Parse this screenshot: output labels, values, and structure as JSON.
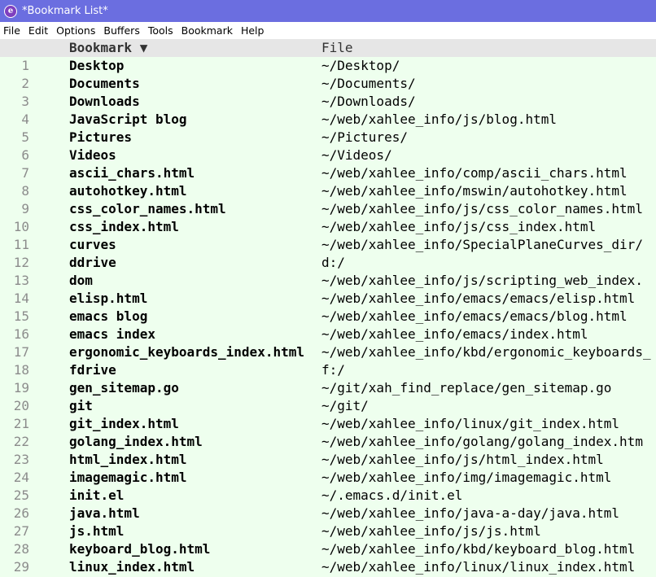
{
  "window": {
    "title": "*Bookmark List*",
    "icon": "emacs-icon"
  },
  "menubar": [
    "File",
    "Edit",
    "Options",
    "Buffers",
    "Tools",
    "Bookmark",
    "Help"
  ],
  "header": {
    "bookmark": "Bookmark ▼",
    "file": "File"
  },
  "rows": [
    {
      "n": "1",
      "name": "Desktop",
      "file": "~/Desktop/"
    },
    {
      "n": "2",
      "name": "Documents",
      "file": "~/Documents/"
    },
    {
      "n": "3",
      "name": "Downloads",
      "file": "~/Downloads/"
    },
    {
      "n": "4",
      "name": "JavaScript blog",
      "file": "~/web/xahlee_info/js/blog.html"
    },
    {
      "n": "5",
      "name": "Pictures",
      "file": "~/Pictures/"
    },
    {
      "n": "6",
      "name": "Videos",
      "file": "~/Videos/"
    },
    {
      "n": "7",
      "name": "ascii_chars.html",
      "file": "~/web/xahlee_info/comp/ascii_chars.html"
    },
    {
      "n": "8",
      "name": "autohotkey.html",
      "file": "~/web/xahlee_info/mswin/autohotkey.html"
    },
    {
      "n": "9",
      "name": "css_color_names.html",
      "file": "~/web/xahlee_info/js/css_color_names.html"
    },
    {
      "n": "10",
      "name": "css_index.html",
      "file": "~/web/xahlee_info/js/css_index.html"
    },
    {
      "n": "11",
      "name": "curves",
      "file": "~/web/xahlee_info/SpecialPlaneCurves_dir/"
    },
    {
      "n": "12",
      "name": "ddrive",
      "file": "d:/"
    },
    {
      "n": "13",
      "name": "dom",
      "file": "~/web/xahlee_info/js/scripting_web_index."
    },
    {
      "n": "14",
      "name": "elisp.html",
      "file": "~/web/xahlee_info/emacs/emacs/elisp.html"
    },
    {
      "n": "15",
      "name": "emacs blog",
      "file": "~/web/xahlee_info/emacs/emacs/blog.html"
    },
    {
      "n": "16",
      "name": "emacs index",
      "file": "~/web/xahlee_info/emacs/index.html"
    },
    {
      "n": "17",
      "name": "ergonomic_keyboards_index.html",
      "file": "~/web/xahlee_info/kbd/ergonomic_keyboards_"
    },
    {
      "n": "18",
      "name": "fdrive",
      "file": "f:/"
    },
    {
      "n": "19",
      "name": "gen_sitemap.go",
      "file": "~/git/xah_find_replace/gen_sitemap.go"
    },
    {
      "n": "20",
      "name": "git",
      "file": "~/git/"
    },
    {
      "n": "21",
      "name": "git_index.html",
      "file": "~/web/xahlee_info/linux/git_index.html"
    },
    {
      "n": "22",
      "name": "golang_index.html",
      "file": "~/web/xahlee_info/golang/golang_index.htm"
    },
    {
      "n": "23",
      "name": "html_index.html",
      "file": "~/web/xahlee_info/js/html_index.html"
    },
    {
      "n": "24",
      "name": "imagemagic.html",
      "file": "~/web/xahlee_info/img/imagemagic.html"
    },
    {
      "n": "25",
      "name": "init.el",
      "file": "~/.emacs.d/init.el"
    },
    {
      "n": "26",
      "name": "java.html",
      "file": "~/web/xahlee_info/java-a-day/java.html"
    },
    {
      "n": "27",
      "name": "js.html",
      "file": "~/web/xahlee_info/js/js.html"
    },
    {
      "n": "28",
      "name": "keyboard_blog.html",
      "file": "~/web/xahlee_info/kbd/keyboard_blog.html"
    },
    {
      "n": "29",
      "name": "linux_index.html",
      "file": "~/web/xahlee_info/linux/linux_index.html"
    }
  ]
}
